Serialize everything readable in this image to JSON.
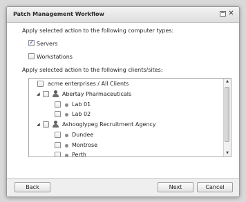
{
  "dialog": {
    "title": "Patch Management Workflow"
  },
  "computer_types": {
    "heading": "Apply selected action to the following computer types:",
    "items": [
      {
        "label": "Servers",
        "checked": true
      },
      {
        "label": "Workstations",
        "checked": false
      }
    ]
  },
  "clients": {
    "heading": "Apply selected action to the following clients/sites:",
    "tree": [
      {
        "label": "acme enterprises / All Clients",
        "level": 0,
        "icon": "none",
        "checked": false
      },
      {
        "label": "Abertay Pharmaceuticals",
        "level": 1,
        "icon": "person-icon",
        "expanded": true,
        "checked": false
      },
      {
        "label": "Lab 01",
        "level": 2,
        "icon": "site-dot-icon",
        "checked": false
      },
      {
        "label": "Lab 02",
        "level": 2,
        "icon": "site-dot-icon",
        "checked": false
      },
      {
        "label": "Ashooglypeg Recruitment Agency",
        "level": 1,
        "icon": "person-icon",
        "expanded": true,
        "checked": false
      },
      {
        "label": "Dundee",
        "level": 2,
        "icon": "site-dot-icon",
        "checked": false
      },
      {
        "label": "Montrose",
        "level": 2,
        "icon": "site-dot-icon",
        "checked": false
      },
      {
        "label": "Perth",
        "level": 2,
        "icon": "site-dot-icon",
        "checked": false
      }
    ]
  },
  "footer": {
    "back_label": "Back",
    "next_label": "Next",
    "cancel_label": "Cancel"
  },
  "colors": {
    "check_accent": "#2c55a5",
    "dialog_bg": "#ffffff",
    "footer_bg": "#efefef"
  }
}
